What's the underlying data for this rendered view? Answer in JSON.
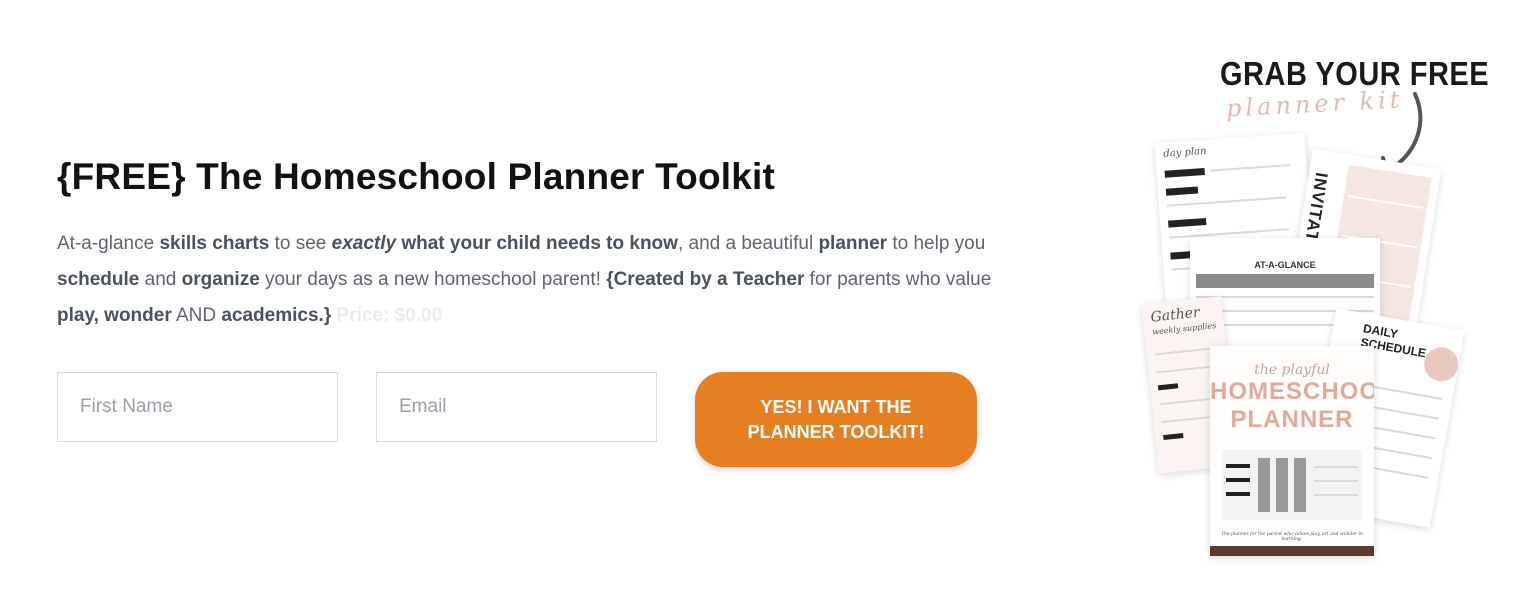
{
  "heading": "{FREE} The Homeschool Planner Toolkit",
  "description": {
    "p1": "At-a-glance ",
    "b1": "skills charts",
    "p2": " to see ",
    "i1": "exactly",
    "b2": " what your child needs to know",
    "p3": ", and a beautiful ",
    "b3": "planner",
    "p4": " to help you ",
    "b4": "schedule",
    "p5": " and ",
    "b5": "organize",
    "p6": " your days as a new homeschool parent! ",
    "b6": "{Created by a Teacher",
    "p7": " for parents who value ",
    "b7": "play, wonder",
    "p8": " AND ",
    "b8": "academics.}",
    "price": " Price: $0.00"
  },
  "form": {
    "first_name_placeholder": "First Name",
    "email_placeholder": "Email",
    "submit_label": "YES! I WANT THE PLANNER TOOLKIT!"
  },
  "promo": {
    "grab_text": "GRAB YOUR FREE",
    "kit_text": "planner kit",
    "card_day_plan": "day plan",
    "card_invitations": "INVITATIONS",
    "card_glance_title": "AT-A-GLANCE",
    "card_gather": "Gather",
    "card_gather_sub": "weekly supplies",
    "card_daily_schedule": "DAILY SCHEDULE",
    "cover_script": "the playful",
    "cover_title_1": "HOMESCHOOL",
    "cover_title_2": "PLANNER",
    "cover_tagline": "The planner for the parent who values play, art and wonder in learning."
  },
  "colors": {
    "accent": "#e67e22",
    "title": "#111111",
    "body_text": "#5d6470",
    "pink": "#e0a99b",
    "brown": "#5b3a2a"
  }
}
